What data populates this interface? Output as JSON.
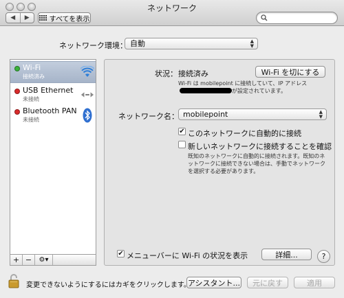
{
  "window": {
    "title": "ネットワーク"
  },
  "toolbar": {
    "back_glyph": "◀",
    "forward_glyph": "▶",
    "show_all_label": "すべてを表示",
    "search_placeholder": ""
  },
  "location": {
    "label": "ネットワーク環境：",
    "value": "自動"
  },
  "services": [
    {
      "name": "Wi-Fi",
      "status": "接続済み",
      "status_color": "#3bb33b",
      "icon": "wifi-icon",
      "selected": true
    },
    {
      "name": "USB Ethernet",
      "status": "未接続",
      "status_color": "#d92b2b",
      "icon": "ethernet-icon",
      "selected": false
    },
    {
      "name": "Bluetooth PAN",
      "status": "未接続",
      "status_color": "#d92b2b",
      "icon": "bluetooth-icon",
      "selected": false
    }
  ],
  "sidebar_tools": {
    "add": "+",
    "remove": "−",
    "action": "⚙▾"
  },
  "detail": {
    "status_label": "状況：",
    "status_value": "接続済み",
    "wifi_off_button": "Wi-Fi を切にする",
    "status_desc_part1": "Wi-Fi は mobilepoint に接続していて、IP アドレス",
    "status_desc_part2": "が設定されています。",
    "network_name_label": "ネットワーク名：",
    "network_name_value": "mobilepoint",
    "auto_join_label": "このネットワークに自動的に接続",
    "auto_join_checked": true,
    "ask_join_label": "新しいネットワークに接続することを確認",
    "ask_join_checked": false,
    "ask_join_desc": "既知のネットワークに自動的に接続されます。既知のネットワークに接続できない場合は、手動でネットワークを選択する必要があります。",
    "show_menu_label": "メニューバーに Wi-Fi の状況を表示",
    "show_menu_checked": true,
    "advanced_button": "詳細...",
    "help_glyph": "?"
  },
  "footer": {
    "lock_text": "変更できないようにするにはカギをクリックします。",
    "assistant_button": "アシスタント...",
    "revert_button": "元に戻す",
    "apply_button": "適用"
  },
  "colors": {
    "selection": "#a9b7cc",
    "background": "#ececec"
  }
}
